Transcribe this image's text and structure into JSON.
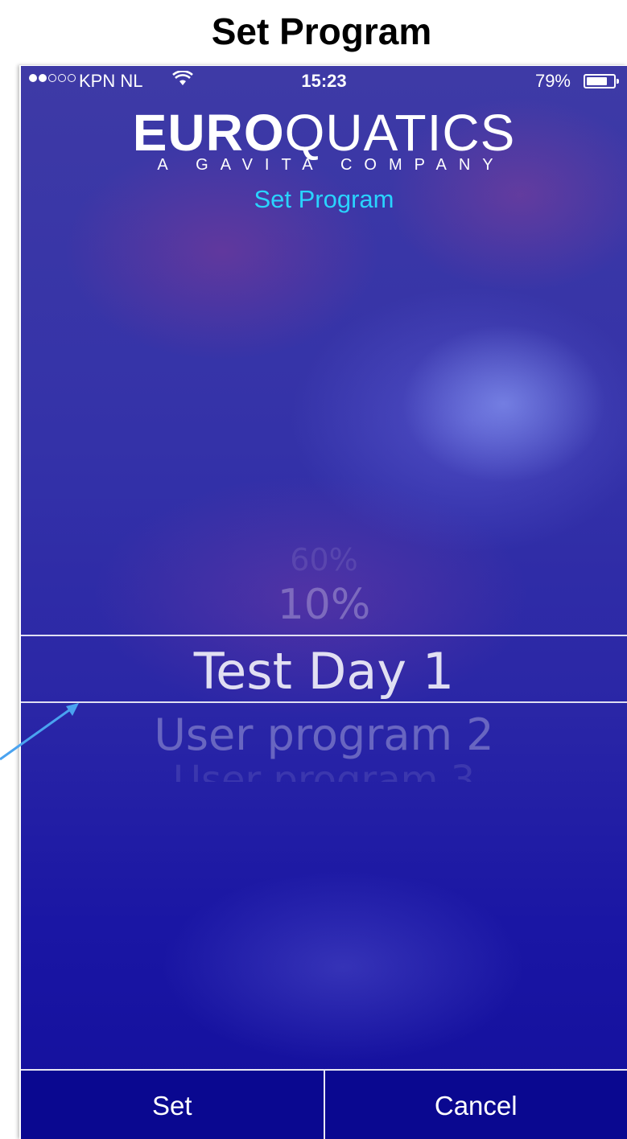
{
  "page": {
    "title": "Set Program"
  },
  "status_bar": {
    "carrier": "KPN NL",
    "time": "15:23",
    "battery_percent": "79%",
    "battery_level": 0.79,
    "signal_bars_filled": 2,
    "signal_bars_total": 5
  },
  "logo": {
    "bold": "EURO",
    "thin": "QUATICS",
    "tagline": "A GAVITA COMPANY"
  },
  "screen": {
    "title": "Set Program"
  },
  "picker": {
    "options": [
      "60%",
      "10%",
      "Test Day 1",
      "User program 2",
      "User program 3"
    ],
    "row_faint_top": "60%",
    "row_prev": "10%",
    "row_selected": "Test Day 1",
    "row_next": "User program 2",
    "row_faint_bottom": "User program 3"
  },
  "buttons": {
    "set": "Set",
    "cancel": "Cancel"
  },
  "colors": {
    "accent": "#29d4ff",
    "background": "#2a26a6",
    "button_bar": "#0a0890",
    "arrow": "#4aa3f0"
  },
  "icons": {
    "wifi": "wifi-icon",
    "battery": "battery-icon",
    "arrow": "arrow-icon"
  }
}
